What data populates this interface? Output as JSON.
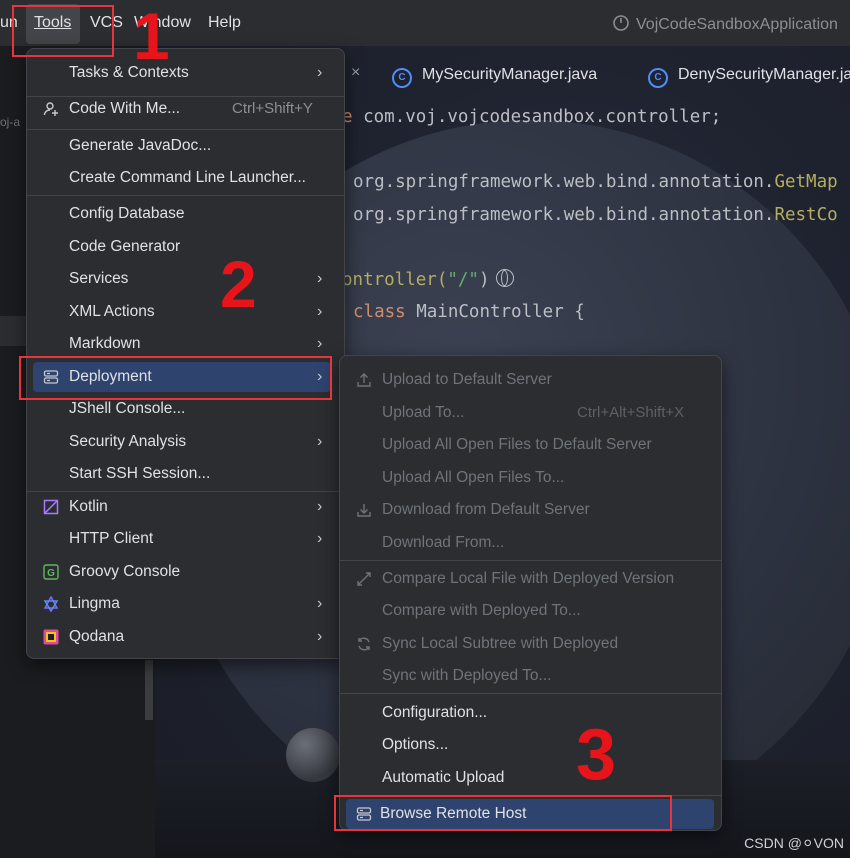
{
  "menubar": {
    "items": [
      "un",
      "Tools",
      "VCS",
      "Window",
      "Help"
    ],
    "app_title": "VojCodeSandboxApplication"
  },
  "breadcrumb_fragment": "oj-a",
  "tabs": {
    "close_symbol": "×",
    "items": [
      "MySecurityManager.java",
      "DenySecurityManager.ja"
    ]
  },
  "code": {
    "line1_keyword": "e",
    "line1_rest": " com.voj.vojcodesandbox.controller;",
    "line2_pkg": "org.springframework.web.bind.annotation.",
    "line2_ann": "GetMap",
    "line3_pkg": "org.springframework.web.bind.annotation.",
    "line3_ann": "RestCo",
    "line4_fn": "ontroller(",
    "line4_str": "\"/\"",
    "line4_end": ")",
    "line5_kw": "class",
    "line5_rest": " MainController {"
  },
  "tools_menu": {
    "items": [
      {
        "label": "Tasks & Contexts",
        "submenu": true,
        "icon": ""
      },
      {
        "label": "Code With Me...",
        "shortcut": "Ctrl+Shift+Y",
        "icon": "user-plus-icon"
      },
      {
        "label": "Generate JavaDoc...",
        "icon": ""
      },
      {
        "label": "Create Command Line Launcher...",
        "icon": ""
      },
      {
        "label": "Config Database",
        "icon": ""
      },
      {
        "label": "Code Generator",
        "icon": ""
      },
      {
        "label": "Services",
        "submenu": true,
        "icon": ""
      },
      {
        "label": "XML Actions",
        "submenu": true,
        "icon": ""
      },
      {
        "label": "Markdown",
        "submenu": true,
        "icon": ""
      },
      {
        "label": "Deployment",
        "submenu": true,
        "icon": "server-icon",
        "selected": true
      },
      {
        "label": "JShell Console...",
        "icon": ""
      },
      {
        "label": "Security Analysis",
        "submenu": true,
        "icon": ""
      },
      {
        "label": "Start SSH Session...",
        "icon": ""
      },
      {
        "label": "Kotlin",
        "submenu": true,
        "icon": "kotlin-icon"
      },
      {
        "label": "HTTP Client",
        "submenu": true,
        "icon": ""
      },
      {
        "label": "Groovy Console",
        "icon": "groovy-icon"
      },
      {
        "label": "Lingma",
        "submenu": true,
        "icon": "lingma-icon"
      },
      {
        "label": "Qodana",
        "submenu": true,
        "icon": "qodana-icon"
      }
    ]
  },
  "deployment_menu": {
    "items": [
      {
        "label": "Upload to Default Server",
        "disabled": true,
        "icon": "upload-icon"
      },
      {
        "label": "Upload To...",
        "shortcut": "Ctrl+Alt+Shift+X",
        "disabled": true
      },
      {
        "label": "Upload All Open Files to Default Server",
        "disabled": true
      },
      {
        "label": "Upload All Open Files To...",
        "disabled": true
      },
      {
        "label": "Download from Default Server",
        "disabled": true,
        "icon": "download-icon"
      },
      {
        "label": "Download From...",
        "disabled": true
      },
      {
        "label": "Compare Local File with Deployed Version",
        "disabled": true,
        "icon": "compare-icon"
      },
      {
        "label": "Compare with Deployed To...",
        "disabled": true
      },
      {
        "label": "Sync Local Subtree with Deployed",
        "disabled": true,
        "icon": "sync-icon"
      },
      {
        "label": "Sync with Deployed To...",
        "disabled": true
      },
      {
        "label": "Configuration...",
        "disabled": false
      },
      {
        "label": "Options...",
        "disabled": false
      },
      {
        "label": "Automatic Upload",
        "disabled": false
      },
      {
        "label": "Browse Remote Host",
        "disabled": false,
        "icon": "server-icon",
        "selected": true
      }
    ]
  },
  "annotations": [
    "1",
    "2",
    "3"
  ],
  "watermark": "CSDN @⚪VON",
  "colors": {
    "accent_red": "#e8343c",
    "selection": "#2e436e",
    "menu_bg": "#2b2d30"
  }
}
